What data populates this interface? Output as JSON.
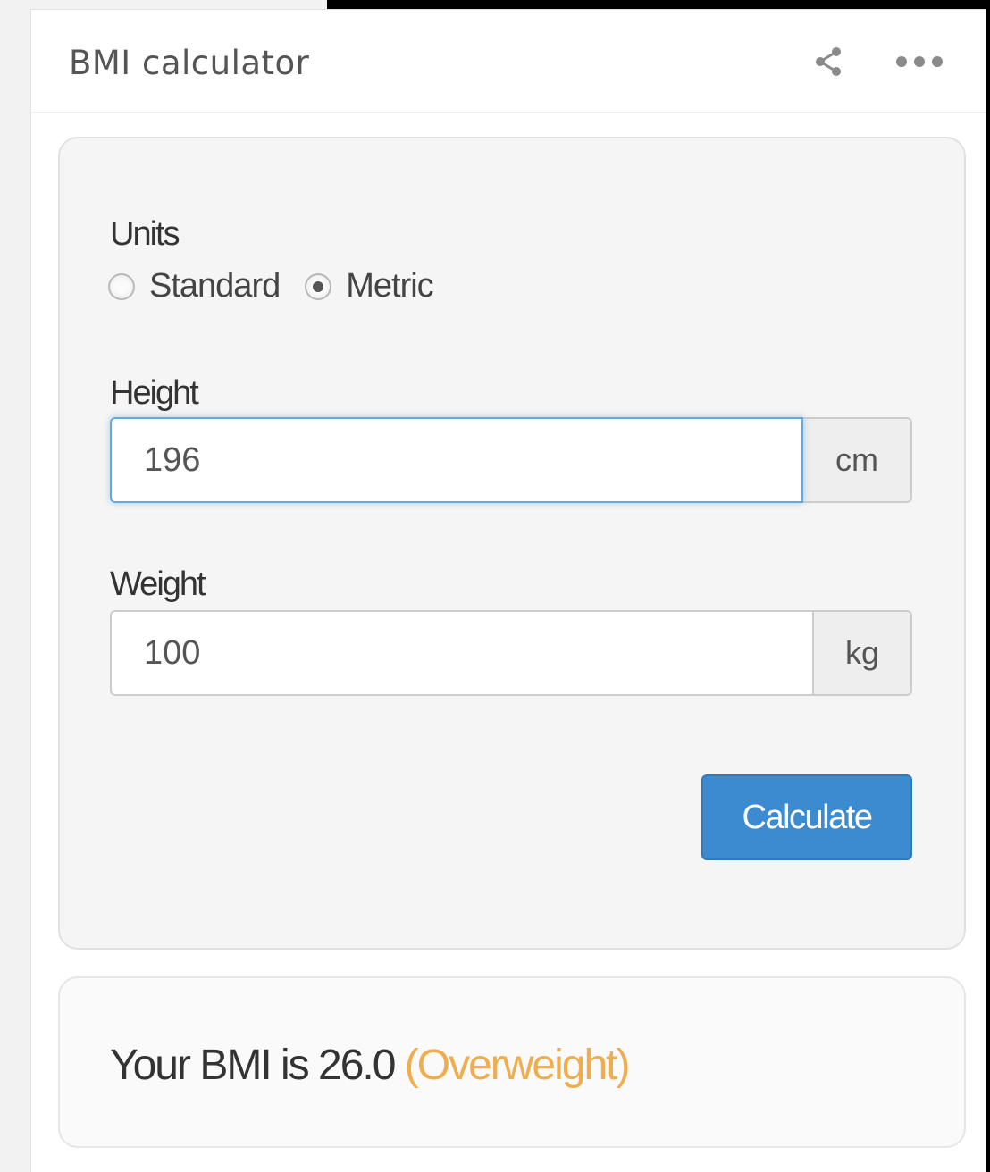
{
  "widget": {
    "title": "BMI calculator",
    "icons": {
      "share": "share-icon",
      "more": "more-options-icon"
    }
  },
  "form": {
    "units_label": "Units",
    "units_options": [
      {
        "label": "Standard",
        "selected": false
      },
      {
        "label": "Metric",
        "selected": true
      }
    ],
    "height": {
      "label": "Height",
      "value": "196",
      "unit": "cm"
    },
    "weight": {
      "label": "Weight",
      "value": "100",
      "unit": "kg"
    },
    "calculate_label": "Calculate"
  },
  "result": {
    "prefix": "Your BMI is 26.0",
    "category": "(Overweight)"
  },
  "colors": {
    "primary_button": "#3c8bd0",
    "category_text": "#f0ad4e",
    "focus_border": "#66a9e0"
  }
}
